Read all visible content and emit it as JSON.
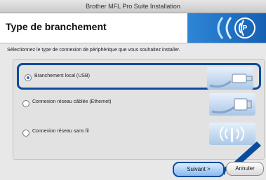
{
  "window": {
    "title": "Brother MFL Pro Suite Installation"
  },
  "header": {
    "title": "Type de branchement"
  },
  "content": {
    "instructions": "Sélectionnez le type de connexion de périphérique que vous souhaitez installer.",
    "options": [
      {
        "label": "Branchement local (USB)",
        "selected": true,
        "icon": "usb-cable-icon"
      },
      {
        "label": "Connexion réseau câblée (Ethernet)",
        "selected": false,
        "icon": "ethernet-cable-icon"
      },
      {
        "label": "Connexion réseau sans fil",
        "selected": false,
        "icon": "wireless-icon"
      }
    ]
  },
  "buttons": {
    "next": "Suivant >",
    "cancel": "Annuler"
  },
  "colors": {
    "accent": "#0a4c9c",
    "header_band": "#1660b4",
    "selected_radio": "#3a6ec4"
  }
}
